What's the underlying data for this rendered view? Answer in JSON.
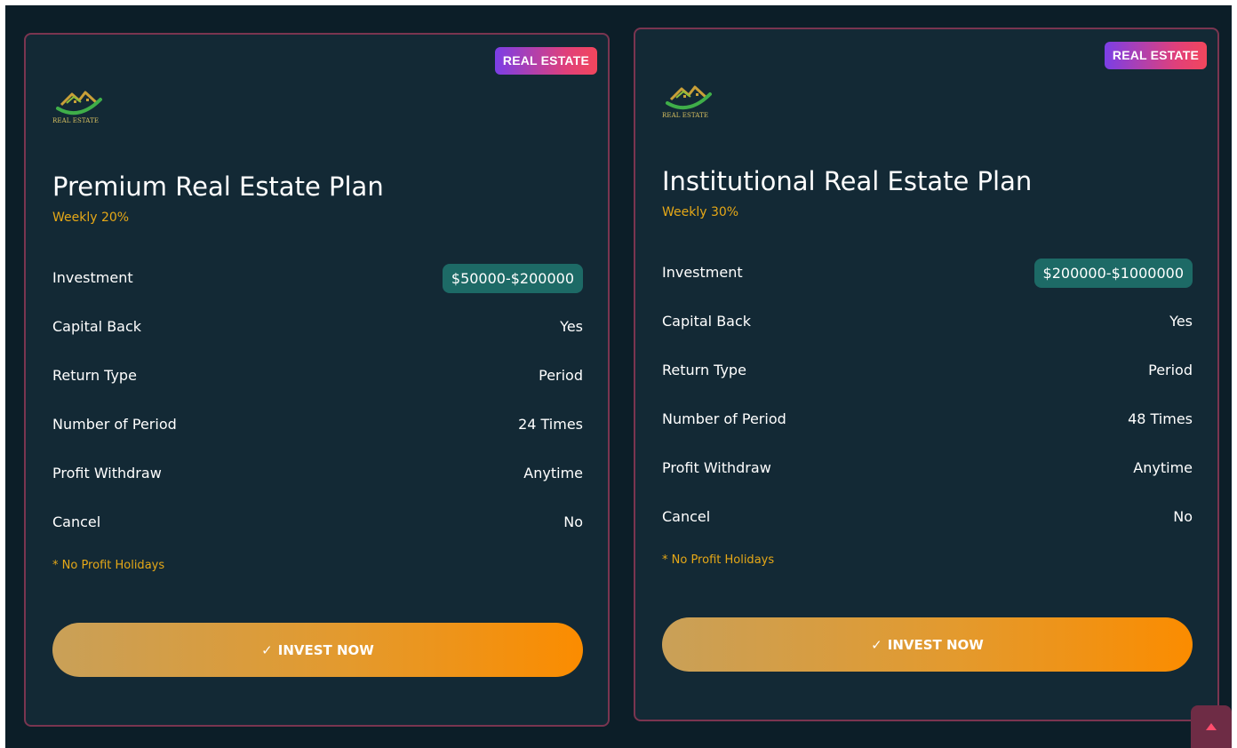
{
  "plans": [
    {
      "badge": "REAL ESTATE",
      "logo_text": "REAL ESTATE",
      "title": "Premium Real Estate Plan",
      "rate": "Weekly 20%",
      "rows": [
        {
          "label": "Investment",
          "value": "$50000-$200000"
        },
        {
          "label": "Capital Back",
          "value": "Yes"
        },
        {
          "label": "Return Type",
          "value": "Period"
        },
        {
          "label": "Number of Period",
          "value": "24 Times"
        },
        {
          "label": "Profit Withdraw",
          "value": "Anytime"
        },
        {
          "label": "Cancel",
          "value": "No"
        }
      ],
      "note": "* No Profit Holidays",
      "button": {
        "icon": "✓",
        "label": "INVEST NOW"
      }
    },
    {
      "badge": "REAL ESTATE",
      "logo_text": "REAL ESTATE",
      "title": "Institutional Real Estate Plan",
      "rate": "Weekly 30%",
      "rows": [
        {
          "label": "Investment",
          "value": "$200000-$1000000"
        },
        {
          "label": "Capital Back",
          "value": "Yes"
        },
        {
          "label": "Return Type",
          "value": "Period"
        },
        {
          "label": "Number of Period",
          "value": "48 Times"
        },
        {
          "label": "Profit Withdraw",
          "value": "Anytime"
        },
        {
          "label": "Cancel",
          "value": "No"
        }
      ],
      "note": "* No Profit Holidays",
      "button": {
        "icon": "✓",
        "label": "INVEST NOW"
      }
    }
  ],
  "scroll_top": {
    "icon": "caret-up-icon"
  },
  "colors": {
    "background": "#0c1e28",
    "card": "#132935",
    "card_border": "#7a3550",
    "accent_text": "#e6a817",
    "investment_pill": "#1d6a66",
    "button_start": "#c9a058",
    "button_end": "#fb8c00",
    "badge_start": "#7b3fe6",
    "badge_end": "#f2465c"
  }
}
